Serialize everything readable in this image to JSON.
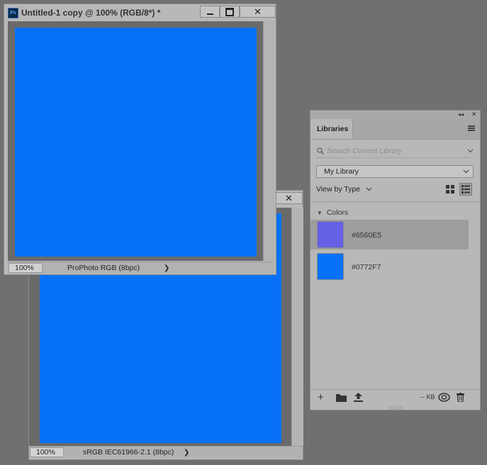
{
  "doc1": {
    "title": "Untitled-1 copy @ 100% (RGB/8*) *",
    "ps_logo": "Ps",
    "canvas_color": "#0772F7",
    "zoom": "100%",
    "profile": "ProPhoto RGB (8bpc)"
  },
  "doc2": {
    "canvas_color": "#0772F7",
    "zoom": "100%",
    "profile": "sRGB IEC61966-2.1 (8bpc)"
  },
  "panel": {
    "tab": "Libraries",
    "search_placeholder": "Search Current Library",
    "library": "My Library",
    "view_by": "View by Type",
    "section": "Colors",
    "colors": [
      {
        "hex": "#6560E5",
        "label": "#6560E5",
        "selected": true
      },
      {
        "hex": "#0772F7",
        "label": "#0772F7",
        "selected": false
      }
    ],
    "storage": "-- KB"
  },
  "icons": [
    "photoshop-logo-icon",
    "minimize-icon",
    "maximize-icon",
    "close-icon",
    "search-icon",
    "chevron-down-icon",
    "grid-view-icon",
    "list-view-icon",
    "add-icon",
    "folder-icon",
    "upload-icon",
    "creative-cloud-icon",
    "trash-icon",
    "panel-menu-icon",
    "collapse-icon"
  ]
}
